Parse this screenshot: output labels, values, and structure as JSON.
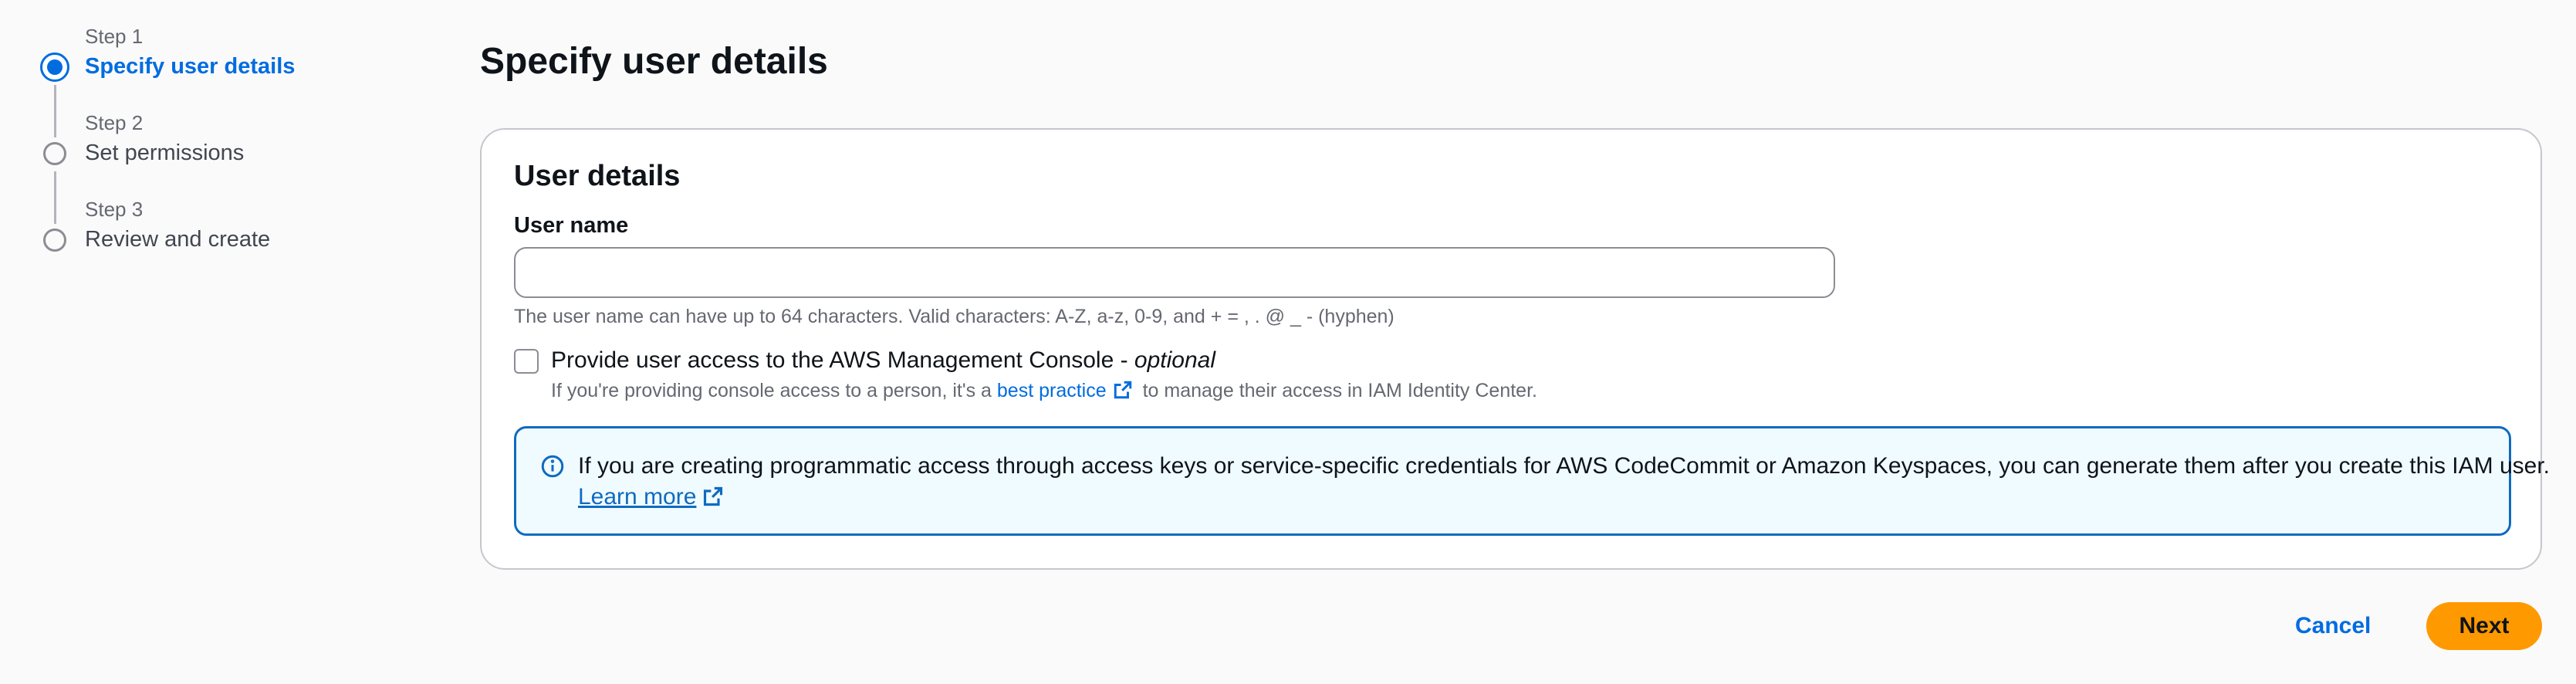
{
  "steps": [
    {
      "number": "Step 1",
      "title": "Specify user details",
      "active": true
    },
    {
      "number": "Step 2",
      "title": "Set permissions",
      "active": false
    },
    {
      "number": "Step 3",
      "title": "Review and create",
      "active": false
    }
  ],
  "page": {
    "title": "Specify user details"
  },
  "user_details": {
    "title": "User details",
    "username_label": "User name",
    "username_value": "",
    "username_placeholder": "",
    "username_hint": "The user name can have up to 64 characters. Valid characters: A-Z, a-z, 0-9, and + = , . @ _ - (hyphen)",
    "console_access": {
      "checked": false,
      "label": "Provide user access to the AWS Management Console - ",
      "label_optional": "optional",
      "desc_before": "If you're providing console access to a person, it's a ",
      "desc_link": "best practice",
      "desc_after": " to manage their access in IAM Identity Center."
    },
    "info_alert": {
      "text": "If you are creating programmatic access through access keys or service-specific credentials for AWS CodeCommit or Amazon Keyspaces, you can generate them after you create this IAM user.",
      "link": "Learn more"
    }
  },
  "footer": {
    "cancel_label": "Cancel",
    "next_label": "Next"
  },
  "colors": {
    "accent": "#006ce0",
    "primary_button": "#ff9900",
    "alert_border": "#0f6ac1",
    "alert_bg": "#f0fbff"
  },
  "icons": {
    "external_link": "external-link-icon",
    "info": "info-icon"
  }
}
